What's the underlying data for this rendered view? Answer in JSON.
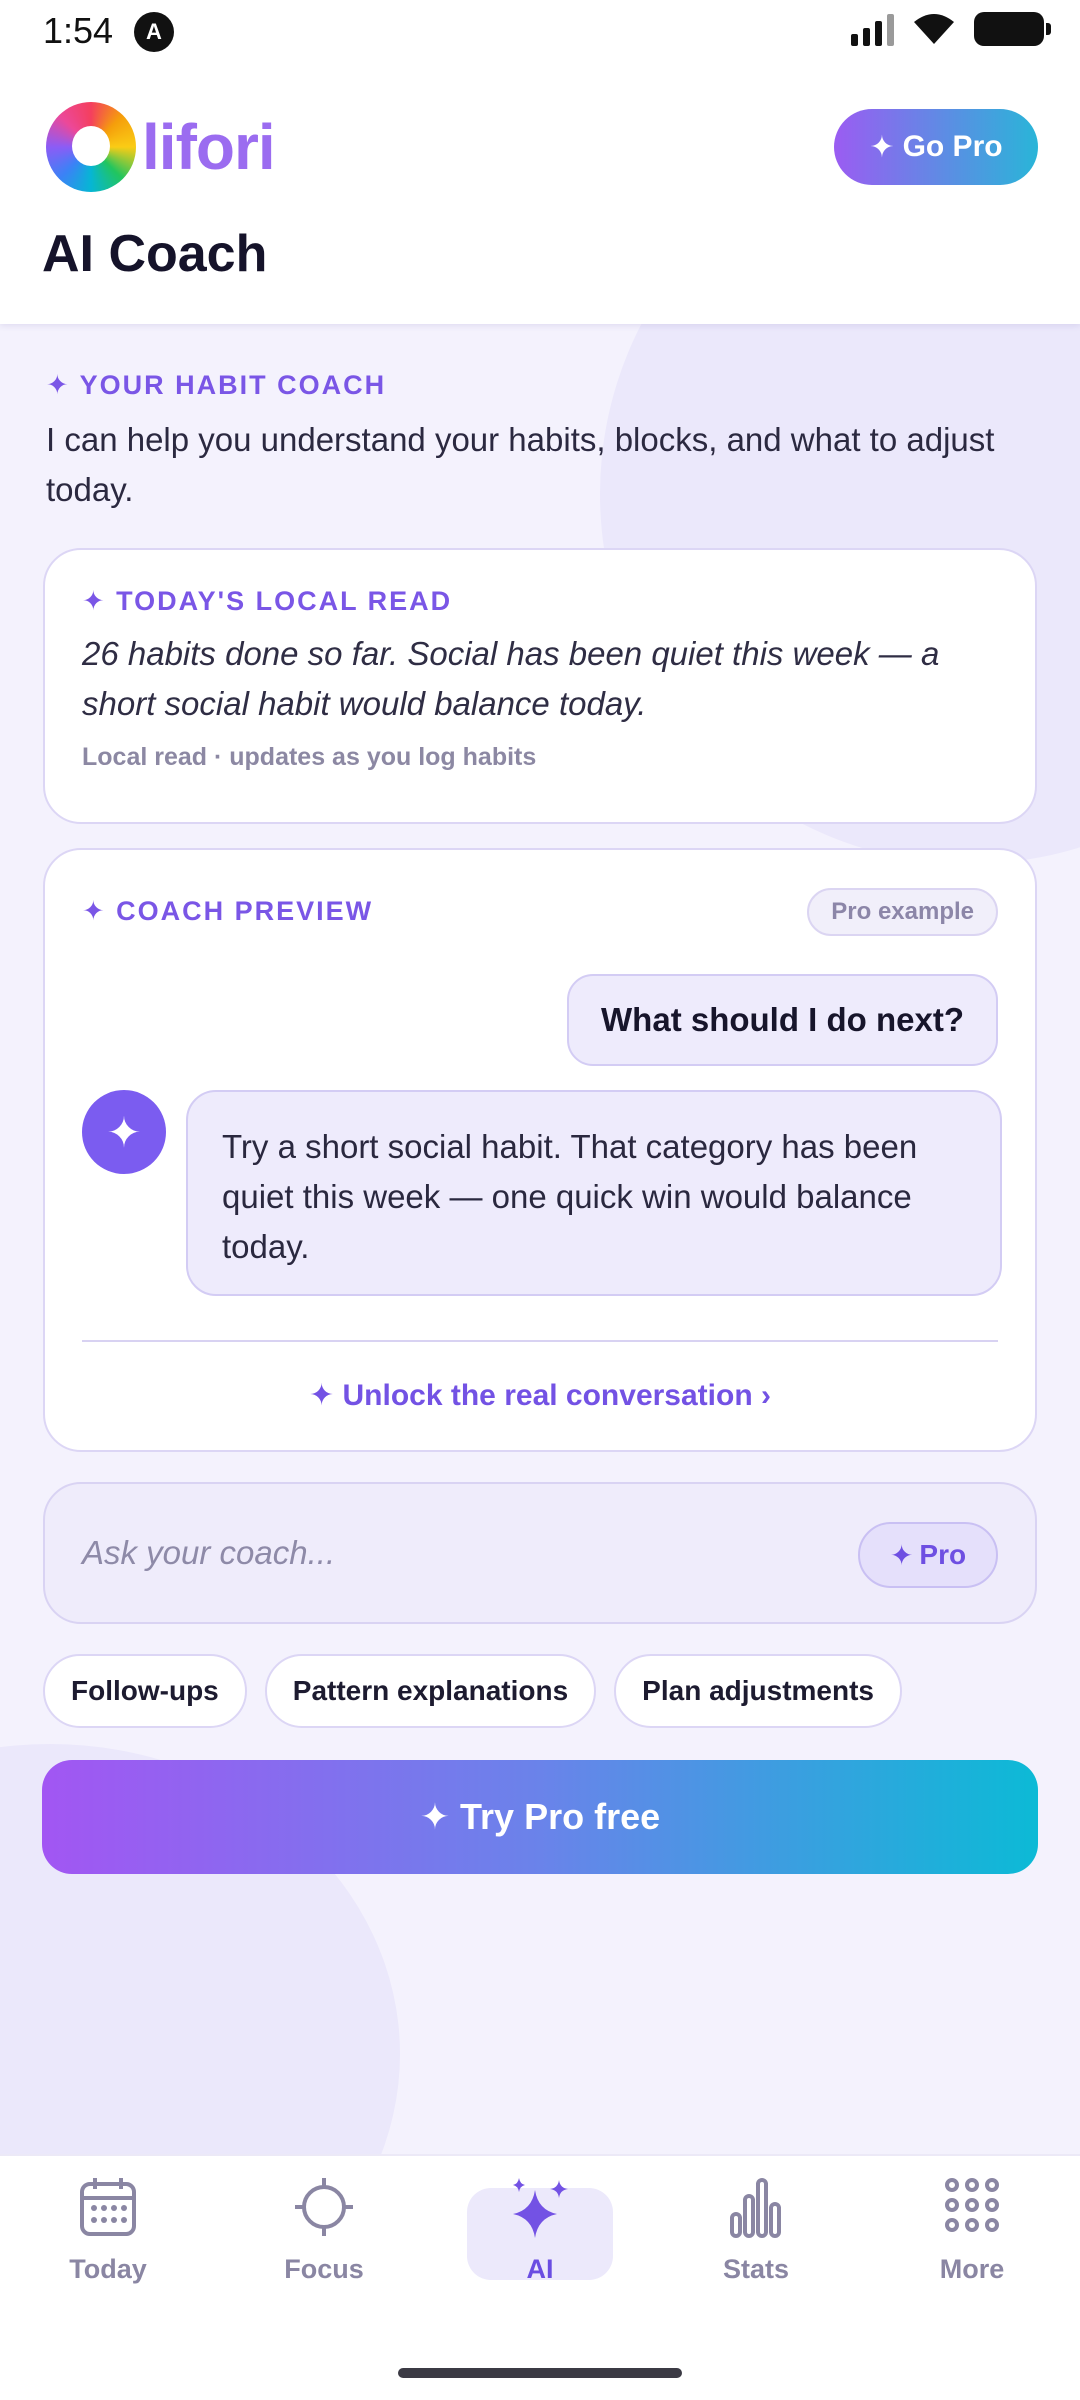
{
  "status_bar": {
    "time": "1:54",
    "app_icon": "A"
  },
  "header": {
    "logo_text": "lifori",
    "go_pro_label": "Go Pro",
    "title": "AI Coach"
  },
  "coach_intro": {
    "label": "YOUR HABIT COACH",
    "text": "I can help you understand your habits, blocks, and what to adjust today."
  },
  "local_read": {
    "label": "TODAY'S LOCAL READ",
    "text": "26 habits done so far. Social has been quiet this week — a short social habit would balance today.",
    "meta": "Local read · updates as you log habits"
  },
  "coach_preview": {
    "label": "COACH PREVIEW",
    "badge": "Pro example",
    "user_message": "What should I do next?",
    "coach_message": "Try a short social habit. That category has been quiet this week — one quick win would balance today.",
    "unlock_label": "Unlock the real conversation ›"
  },
  "ask_input": {
    "placeholder": "Ask your coach...",
    "pro_label": "Pro"
  },
  "chips": [
    "Follow-ups",
    "Pattern explanations",
    "Plan adjustments"
  ],
  "cta": {
    "label": "Try Pro free"
  },
  "nav": {
    "items": [
      {
        "label": "Today",
        "icon": "calendar-icon"
      },
      {
        "label": "Focus",
        "icon": "crosshair-icon"
      },
      {
        "label": "AI",
        "icon": "sparkles-icon",
        "active": true
      },
      {
        "label": "Stats",
        "icon": "bar-chart-icon"
      },
      {
        "label": "More",
        "icon": "grid-dots-icon"
      }
    ]
  },
  "colors": {
    "accent": "#7352e4",
    "brand_gradient_start": "#a256f3",
    "brand_gradient_end": "#0cbad6",
    "background": "#f4f2fd"
  }
}
